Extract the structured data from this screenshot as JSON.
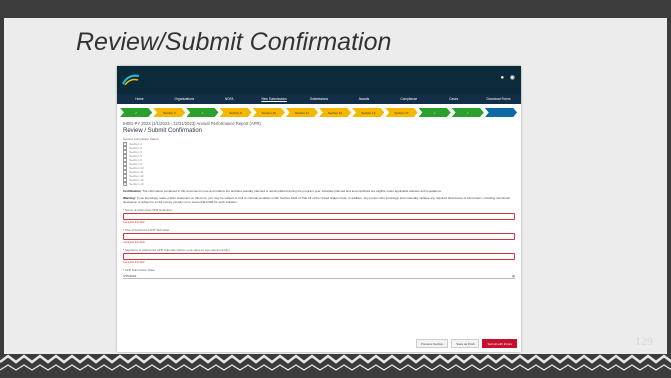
{
  "slide": {
    "title": "Review/Submit Confirmation",
    "number": "129"
  },
  "colors": {
    "header": "#0b2a3a",
    "nav": "#132f47",
    "step_complete": "#2ca02c",
    "step_incomplete": "#f5b700",
    "step_current": "#0a6aa8",
    "error": "#d0343a",
    "submit": "#c8102e"
  },
  "app": {
    "header_icons": [
      "bell-icon",
      "user-icon"
    ],
    "nav_items": [
      "Home",
      "Organizations",
      "NOFA",
      "New Submissions",
      "Submissions",
      "Awards",
      "Compliance",
      "Cases",
      "Download Forms"
    ],
    "steps": [
      {
        "label": "✓",
        "state": "complete"
      },
      {
        "label": "Section 3",
        "state": "incomplete"
      },
      {
        "label": "✓",
        "state": "complete"
      },
      {
        "label": "Section 6",
        "state": "incomplete"
      },
      {
        "label": "Section 10",
        "state": "incomplete"
      },
      {
        "label": "Section 11",
        "state": "incomplete"
      },
      {
        "label": "Section 12",
        "state": "incomplete"
      },
      {
        "label": "Section 13",
        "state": "incomplete"
      },
      {
        "label": "Section 17",
        "state": "incomplete"
      },
      {
        "label": "✓",
        "state": "complete"
      },
      {
        "label": "✓",
        "state": "complete"
      },
      {
        "label": "",
        "state": "current"
      }
    ],
    "breadcrumb": "IHBG-PY 2023 (1/1/2023 - 12/31/2023) Annual Performance Report (APR)",
    "page_title": "Review / Submit Confirmation",
    "status_label": "Section Completion Status",
    "sections": [
      {
        "label": "Section 1",
        "checked": true
      },
      {
        "label": "Section 2",
        "checked": true
      },
      {
        "label": "Section 3",
        "checked": false
      },
      {
        "label": "Section 5",
        "checked": true
      },
      {
        "label": "Section 6",
        "checked": false
      },
      {
        "label": "Section 9",
        "checked": false
      },
      {
        "label": "Section 10",
        "checked": false
      },
      {
        "label": "Section 11",
        "checked": false
      },
      {
        "label": "Section 12",
        "checked": false
      },
      {
        "label": "Section 13",
        "checked": false
      },
      {
        "label": "Section 14",
        "checked": true
      }
    ],
    "certification_label": "Certification:",
    "certification_text": "The information contained in this document is true and reflects the activities actually planned or accomplished during the program year. Activities planned and accomplished are eligible under applicable statutes and regulations.",
    "warning_label": "Warning:",
    "warning_text": "If you knowingly make a false statement on this form, you may be subject to civil or criminal penalties under Section 1001 of Title 18 of the United States Code. In addition, any person who knowingly and materially violates any required disclosures of information, including intentional disclosure, is subject to a civil money penalty not to exceed $10,000 for each violation.",
    "fields": [
      {
        "label": "* Name of Authorized APR Submitter:",
        "error": "Complete this field."
      },
      {
        "label": "* Title of Authorized APR Submitter:",
        "error": "Complete this field."
      },
      {
        "label": "* Signature of Authorized APR Submitter (Enter your name to sign electronically):",
        "error": "Complete this field."
      }
    ],
    "date_label": "* APR Submission Date:",
    "date_value": "3/15/2023",
    "buttons": {
      "previous": "Previous Section",
      "save": "Save as Draft",
      "submit": "Submit with Errors"
    }
  }
}
